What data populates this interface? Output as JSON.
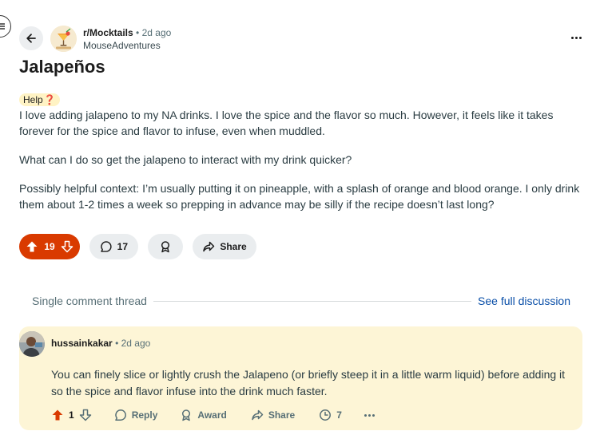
{
  "post": {
    "subreddit": "r/Mocktails",
    "dot": "•",
    "time": "2d ago",
    "author": "MouseAdventures",
    "title": "Jalapeños",
    "flair_text": "Help",
    "flair_emoji": "❓",
    "body": [
      "I love adding jalapeno to my NA drinks. I love the spice and the flavor so much. However, it feels like it takes forever for the spice and flavor to infuse, even when muddled.",
      "What can I do so get the jalapeno to interact with my drink quicker?",
      "Possibly helpful context: I’m usually putting it on pineapple, with a splash of orange and blood orange. I only drink them about 1-2 times a week so prepping in advance may be silly if the recipe doesn’t last long?"
    ],
    "votes": "19",
    "comments": "17",
    "share_label": "Share"
  },
  "thread": {
    "label": "Single comment thread",
    "see_full": "See full discussion"
  },
  "comment": {
    "user": "hussainkakar",
    "dot": "•",
    "time": "2d ago",
    "text": "You can finely slice or lightly crush the Jalapeno (or briefly steep it in a little warm liquid) before adding it so the spice and flavor infuse into the drink much faster.",
    "votes": "1",
    "reply_label": "Reply",
    "award_label": "Award",
    "share_label": "Share",
    "awards_count": "7"
  },
  "colors": {
    "upvote_orange": "#d93a00",
    "comment_highlight": "#fdf5d6",
    "link_blue": "#0a4fa8"
  }
}
